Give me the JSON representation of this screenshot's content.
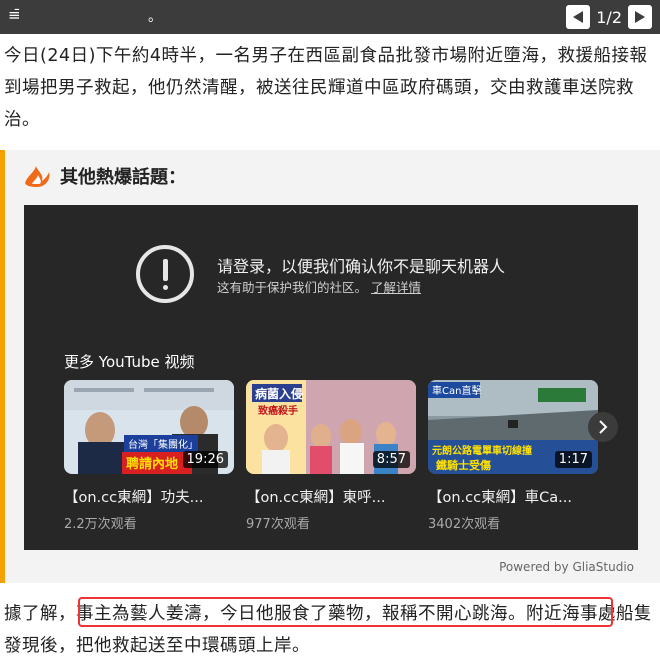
{
  "topbar": {
    "left_text": "≡̄",
    "dot": "。",
    "pager_label": "1/2"
  },
  "article": {
    "paragraph1": "今日(24日)下午約4時半，一名男子在西區副食品批發市場附近墮海，救援船接報到場把男子救起，他仍然清醒，被送往民輝道中區政府碼頭，交由救護車送院救治。",
    "paragraph2_prefix": "據了解，",
    "paragraph2_highlight": "事主為藝人姜濤，今日他服食了藥物，報稱不開心跳海",
    "paragraph2_rest": "。附近海事處船隻發現後，把他救起送至中環碼頭上岸。"
  },
  "hot_topics": {
    "title": "其他熱爆話題："
  },
  "youtube": {
    "message": "请登录，以便我们确认你不是聊天机器人",
    "sub_text": "这有助于保护我们的社区。",
    "learn_more": "了解详情",
    "more_label": "更多 YouTube 视频",
    "videos": [
      {
        "title": "【on.cc東網】功夫...",
        "duration": "19:26",
        "views": "2.2万次观看"
      },
      {
        "title": "【on.cc東網】東呼...",
        "duration": "8:57",
        "views": "977次观看"
      },
      {
        "title": "【on.cc東網】車Ca...",
        "duration": "1:17",
        "views": "3402次观看"
      }
    ],
    "thumb_texts": {
      "t1": "台灣「集團化」",
      "t1b": "聘請內地",
      "t2a": "病菌入侵",
      "t2b": "致癌殺手",
      "t3a": "車Can直擊",
      "t3b": "元朗公路電單車切線撞",
      "t3c": "鐵騎士受傷"
    }
  },
  "powered_by": "Powered by GliaStudio",
  "colors": {
    "accent": "#f5a100",
    "highlight_border": "#e33333",
    "video_panel": "#272727"
  }
}
